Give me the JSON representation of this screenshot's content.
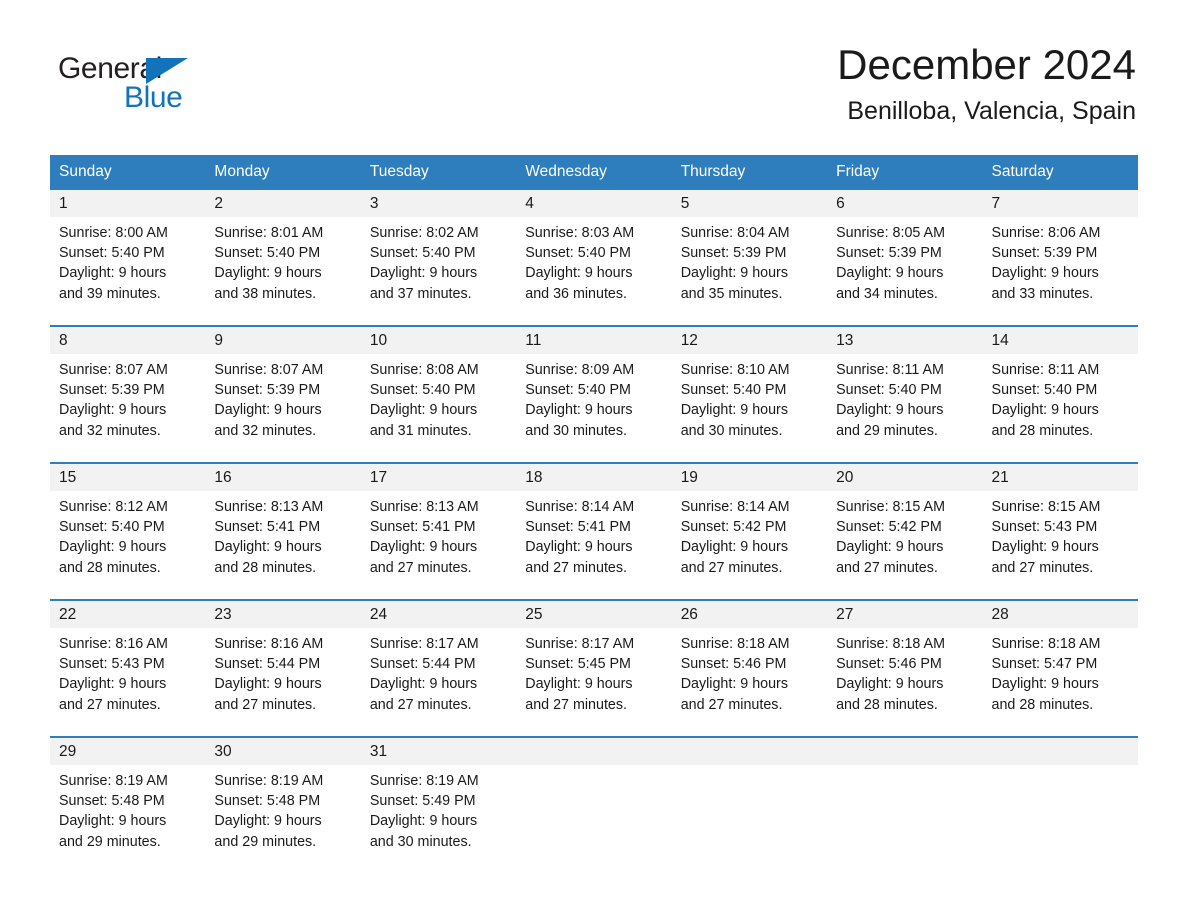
{
  "brand": {
    "name_part1": "General",
    "name_part2": "Blue",
    "triangle_icon": "triangle-icon",
    "color_black": "#231f20",
    "color_blue": "#1273ba"
  },
  "header": {
    "title": "December 2024",
    "subtitle": "Benilloba, Valencia, Spain"
  },
  "theme": {
    "header_bg": "#2e7ebd",
    "day_number_bg": "#f2f2f2",
    "row_rule": "#2e7ebd",
    "text": "#1a1a1a"
  },
  "calendar": {
    "weekdays": [
      "Sunday",
      "Monday",
      "Tuesday",
      "Wednesday",
      "Thursday",
      "Friday",
      "Saturday"
    ],
    "weeks": [
      {
        "numbers": [
          "1",
          "2",
          "3",
          "4",
          "5",
          "6",
          "7"
        ],
        "days": [
          {
            "sunrise": "Sunrise: 8:00 AM",
            "sunset": "Sunset: 5:40 PM",
            "daylight1": "Daylight: 9 hours",
            "daylight2": "and 39 minutes."
          },
          {
            "sunrise": "Sunrise: 8:01 AM",
            "sunset": "Sunset: 5:40 PM",
            "daylight1": "Daylight: 9 hours",
            "daylight2": "and 38 minutes."
          },
          {
            "sunrise": "Sunrise: 8:02 AM",
            "sunset": "Sunset: 5:40 PM",
            "daylight1": "Daylight: 9 hours",
            "daylight2": "and 37 minutes."
          },
          {
            "sunrise": "Sunrise: 8:03 AM",
            "sunset": "Sunset: 5:40 PM",
            "daylight1": "Daylight: 9 hours",
            "daylight2": "and 36 minutes."
          },
          {
            "sunrise": "Sunrise: 8:04 AM",
            "sunset": "Sunset: 5:39 PM",
            "daylight1": "Daylight: 9 hours",
            "daylight2": "and 35 minutes."
          },
          {
            "sunrise": "Sunrise: 8:05 AM",
            "sunset": "Sunset: 5:39 PM",
            "daylight1": "Daylight: 9 hours",
            "daylight2": "and 34 minutes."
          },
          {
            "sunrise": "Sunrise: 8:06 AM",
            "sunset": "Sunset: 5:39 PM",
            "daylight1": "Daylight: 9 hours",
            "daylight2": "and 33 minutes."
          }
        ]
      },
      {
        "numbers": [
          "8",
          "9",
          "10",
          "11",
          "12",
          "13",
          "14"
        ],
        "days": [
          {
            "sunrise": "Sunrise: 8:07 AM",
            "sunset": "Sunset: 5:39 PM",
            "daylight1": "Daylight: 9 hours",
            "daylight2": "and 32 minutes."
          },
          {
            "sunrise": "Sunrise: 8:07 AM",
            "sunset": "Sunset: 5:39 PM",
            "daylight1": "Daylight: 9 hours",
            "daylight2": "and 32 minutes."
          },
          {
            "sunrise": "Sunrise: 8:08 AM",
            "sunset": "Sunset: 5:40 PM",
            "daylight1": "Daylight: 9 hours",
            "daylight2": "and 31 minutes."
          },
          {
            "sunrise": "Sunrise: 8:09 AM",
            "sunset": "Sunset: 5:40 PM",
            "daylight1": "Daylight: 9 hours",
            "daylight2": "and 30 minutes."
          },
          {
            "sunrise": "Sunrise: 8:10 AM",
            "sunset": "Sunset: 5:40 PM",
            "daylight1": "Daylight: 9 hours",
            "daylight2": "and 30 minutes."
          },
          {
            "sunrise": "Sunrise: 8:11 AM",
            "sunset": "Sunset: 5:40 PM",
            "daylight1": "Daylight: 9 hours",
            "daylight2": "and 29 minutes."
          },
          {
            "sunrise": "Sunrise: 8:11 AM",
            "sunset": "Sunset: 5:40 PM",
            "daylight1": "Daylight: 9 hours",
            "daylight2": "and 28 minutes."
          }
        ]
      },
      {
        "numbers": [
          "15",
          "16",
          "17",
          "18",
          "19",
          "20",
          "21"
        ],
        "days": [
          {
            "sunrise": "Sunrise: 8:12 AM",
            "sunset": "Sunset: 5:40 PM",
            "daylight1": "Daylight: 9 hours",
            "daylight2": "and 28 minutes."
          },
          {
            "sunrise": "Sunrise: 8:13 AM",
            "sunset": "Sunset: 5:41 PM",
            "daylight1": "Daylight: 9 hours",
            "daylight2": "and 28 minutes."
          },
          {
            "sunrise": "Sunrise: 8:13 AM",
            "sunset": "Sunset: 5:41 PM",
            "daylight1": "Daylight: 9 hours",
            "daylight2": "and 27 minutes."
          },
          {
            "sunrise": "Sunrise: 8:14 AM",
            "sunset": "Sunset: 5:41 PM",
            "daylight1": "Daylight: 9 hours",
            "daylight2": "and 27 minutes."
          },
          {
            "sunrise": "Sunrise: 8:14 AM",
            "sunset": "Sunset: 5:42 PM",
            "daylight1": "Daylight: 9 hours",
            "daylight2": "and 27 minutes."
          },
          {
            "sunrise": "Sunrise: 8:15 AM",
            "sunset": "Sunset: 5:42 PM",
            "daylight1": "Daylight: 9 hours",
            "daylight2": "and 27 minutes."
          },
          {
            "sunrise": "Sunrise: 8:15 AM",
            "sunset": "Sunset: 5:43 PM",
            "daylight1": "Daylight: 9 hours",
            "daylight2": "and 27 minutes."
          }
        ]
      },
      {
        "numbers": [
          "22",
          "23",
          "24",
          "25",
          "26",
          "27",
          "28"
        ],
        "days": [
          {
            "sunrise": "Sunrise: 8:16 AM",
            "sunset": "Sunset: 5:43 PM",
            "daylight1": "Daylight: 9 hours",
            "daylight2": "and 27 minutes."
          },
          {
            "sunrise": "Sunrise: 8:16 AM",
            "sunset": "Sunset: 5:44 PM",
            "daylight1": "Daylight: 9 hours",
            "daylight2": "and 27 minutes."
          },
          {
            "sunrise": "Sunrise: 8:17 AM",
            "sunset": "Sunset: 5:44 PM",
            "daylight1": "Daylight: 9 hours",
            "daylight2": "and 27 minutes."
          },
          {
            "sunrise": "Sunrise: 8:17 AM",
            "sunset": "Sunset: 5:45 PM",
            "daylight1": "Daylight: 9 hours",
            "daylight2": "and 27 minutes."
          },
          {
            "sunrise": "Sunrise: 8:18 AM",
            "sunset": "Sunset: 5:46 PM",
            "daylight1": "Daylight: 9 hours",
            "daylight2": "and 27 minutes."
          },
          {
            "sunrise": "Sunrise: 8:18 AM",
            "sunset": "Sunset: 5:46 PM",
            "daylight1": "Daylight: 9 hours",
            "daylight2": "and 28 minutes."
          },
          {
            "sunrise": "Sunrise: 8:18 AM",
            "sunset": "Sunset: 5:47 PM",
            "daylight1": "Daylight: 9 hours",
            "daylight2": "and 28 minutes."
          }
        ]
      },
      {
        "numbers": [
          "29",
          "30",
          "31",
          "",
          "",
          "",
          ""
        ],
        "days": [
          {
            "sunrise": "Sunrise: 8:19 AM",
            "sunset": "Sunset: 5:48 PM",
            "daylight1": "Daylight: 9 hours",
            "daylight2": "and 29 minutes."
          },
          {
            "sunrise": "Sunrise: 8:19 AM",
            "sunset": "Sunset: 5:48 PM",
            "daylight1": "Daylight: 9 hours",
            "daylight2": "and 29 minutes."
          },
          {
            "sunrise": "Sunrise: 8:19 AM",
            "sunset": "Sunset: 5:49 PM",
            "daylight1": "Daylight: 9 hours",
            "daylight2": "and 30 minutes."
          },
          {
            "sunrise": "",
            "sunset": "",
            "daylight1": "",
            "daylight2": ""
          },
          {
            "sunrise": "",
            "sunset": "",
            "daylight1": "",
            "daylight2": ""
          },
          {
            "sunrise": "",
            "sunset": "",
            "daylight1": "",
            "daylight2": ""
          },
          {
            "sunrise": "",
            "sunset": "",
            "daylight1": "",
            "daylight2": ""
          }
        ]
      }
    ]
  }
}
